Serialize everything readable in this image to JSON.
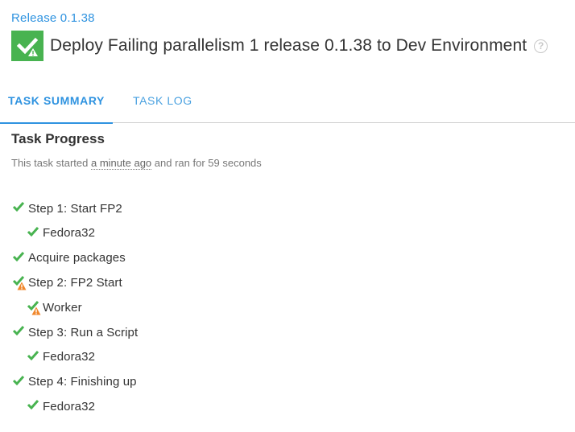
{
  "breadcrumb": "Release 0.1.38",
  "title": "Deploy Failing parallelism 1 release 0.1.38 to Dev Environment",
  "tabs": [
    {
      "label": "TASK SUMMARY",
      "active": true
    },
    {
      "label": "TASK LOG",
      "active": false
    }
  ],
  "task_progress": {
    "heading": "Task Progress",
    "summary_prefix": "This task started",
    "summary_ago": "a minute ago",
    "summary_suffix": "and ran for 59 seconds"
  },
  "steps": [
    {
      "label": "Step 1: Start FP2",
      "level": 0,
      "status": "success"
    },
    {
      "label": "Fedora32",
      "level": 1,
      "status": "success"
    },
    {
      "label": "Acquire packages",
      "level": 0,
      "status": "success"
    },
    {
      "label": "Step 2: FP2 Start",
      "level": 0,
      "status": "success-warning"
    },
    {
      "label": "Worker",
      "level": 1,
      "status": "success-warning"
    },
    {
      "label": "Step 3: Run a Script",
      "level": 0,
      "status": "success"
    },
    {
      "label": "Fedora32",
      "level": 1,
      "status": "success"
    },
    {
      "label": "Step 4: Finishing up",
      "level": 0,
      "status": "success"
    },
    {
      "label": "Fedora32",
      "level": 1,
      "status": "success"
    }
  ],
  "colors": {
    "success": "#48b350",
    "warning": "#f0872b",
    "link": "#2f93e0"
  },
  "icons": {
    "status_box": "check-warning-icon",
    "help": "question-circle-icon",
    "success": "check-icon",
    "warning": "warning-triangle-icon"
  }
}
